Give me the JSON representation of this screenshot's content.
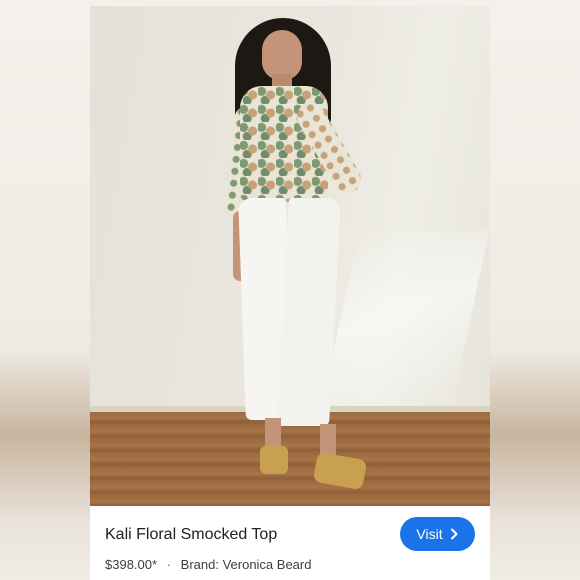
{
  "product": {
    "title": "Kali Floral Smocked Top",
    "price": "$398.00*",
    "separator": "·",
    "brand": "Brand: Veronica Beard"
  },
  "actions": {
    "visit_label": "Visit",
    "visit_icon": "chevron-right-icon"
  },
  "colors": {
    "accent": "#1a73e8",
    "title_text": "#202124",
    "meta_text": "#3c4043"
  }
}
